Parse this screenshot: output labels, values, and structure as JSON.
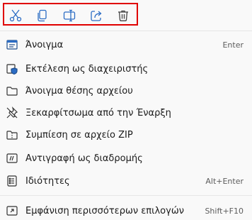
{
  "toolbar": {
    "buttons": [
      {
        "icon": "cut-icon",
        "name": "cut"
      },
      {
        "icon": "copy-icon",
        "name": "copy"
      },
      {
        "icon": "rename-icon",
        "name": "rename"
      },
      {
        "icon": "share-icon",
        "name": "share"
      },
      {
        "icon": "delete-icon",
        "name": "delete"
      }
    ],
    "highlight_color": "#e00000",
    "icon_color": "#2b6cc4"
  },
  "items": [
    {
      "label": "Άνοιγμα",
      "shortcut": "Enter",
      "icon": "open-icon"
    },
    {
      "label": "Εκτέλεση ως διαχειριστής",
      "shortcut": "",
      "icon": "shield-icon"
    },
    {
      "label": "Άνοιγμα θέσης αρχείου",
      "shortcut": "",
      "icon": "folder-icon"
    },
    {
      "label": "Ξεκαρφίτσωμα από την Έναρξη",
      "shortcut": "",
      "icon": "unpin-icon"
    },
    {
      "label": "Συμπίεση σε αρχείο ZIP",
      "shortcut": "",
      "icon": "zip-folder-icon"
    },
    {
      "label": "Αντιγραφή ως διαδρομής",
      "shortcut": "",
      "icon": "copy-path-icon"
    },
    {
      "label": "Ιδιότητες",
      "shortcut": "Alt+Enter",
      "icon": "properties-icon"
    },
    {
      "label": "Εμφάνιση περισσότερων επιλογών",
      "shortcut": "Shift+F10",
      "icon": "more-options-icon"
    }
  ]
}
